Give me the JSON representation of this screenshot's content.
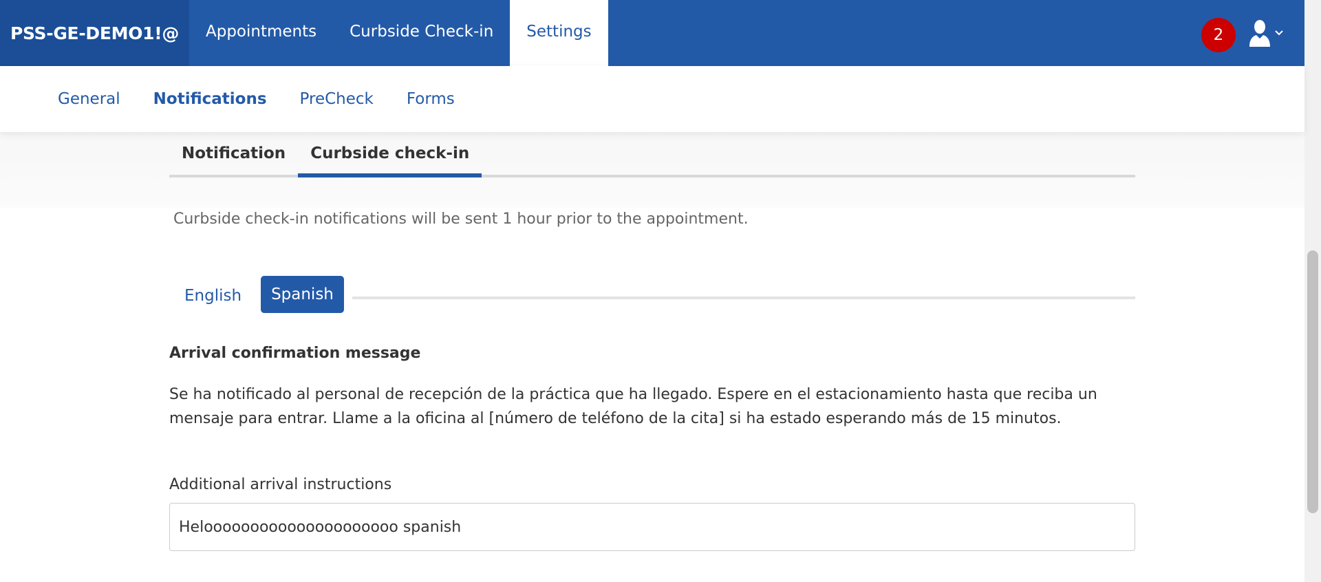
{
  "topbar": {
    "brand": "PSS-GE-DEMO1!@",
    "nav": [
      {
        "label": "Appointments"
      },
      {
        "label": "Curbside Check-in"
      },
      {
        "label": "Settings"
      }
    ],
    "notification_count": "2",
    "user_icon": "user-icon",
    "chevron_icon": "chevron-down-icon"
  },
  "subnav": {
    "items": [
      {
        "label": "General"
      },
      {
        "label": "Notifications"
      },
      {
        "label": "PreCheck"
      },
      {
        "label": "Forms"
      }
    ],
    "active": "Notifications"
  },
  "tabs": {
    "items": [
      {
        "label": "Notification"
      },
      {
        "label": "Curbside check-in"
      }
    ],
    "active": "Curbside check-in"
  },
  "info_text": "Curbside check-in notifications will be sent 1 hour prior to the appointment.",
  "language": {
    "options": [
      {
        "label": "English"
      },
      {
        "label": "Spanish"
      }
    ],
    "active": "Spanish"
  },
  "arrival_confirmation": {
    "title": "Arrival confirmation message",
    "message": "Se ha notificado al personal de recepción de la práctica que ha llegado. Espere en el estacionamiento hasta que reciba un mensaje para entrar. Llame a la oficina al [número de teléfono de la cita] si ha estado esperando más de 15 minutos."
  },
  "additional_instructions": {
    "label": "Additional arrival instructions",
    "value": "Helooooooooooooooooooooo spanish"
  },
  "colors": {
    "primary": "#235aa8",
    "brand_bg": "#1b4e97",
    "badge": "#cc0000"
  }
}
